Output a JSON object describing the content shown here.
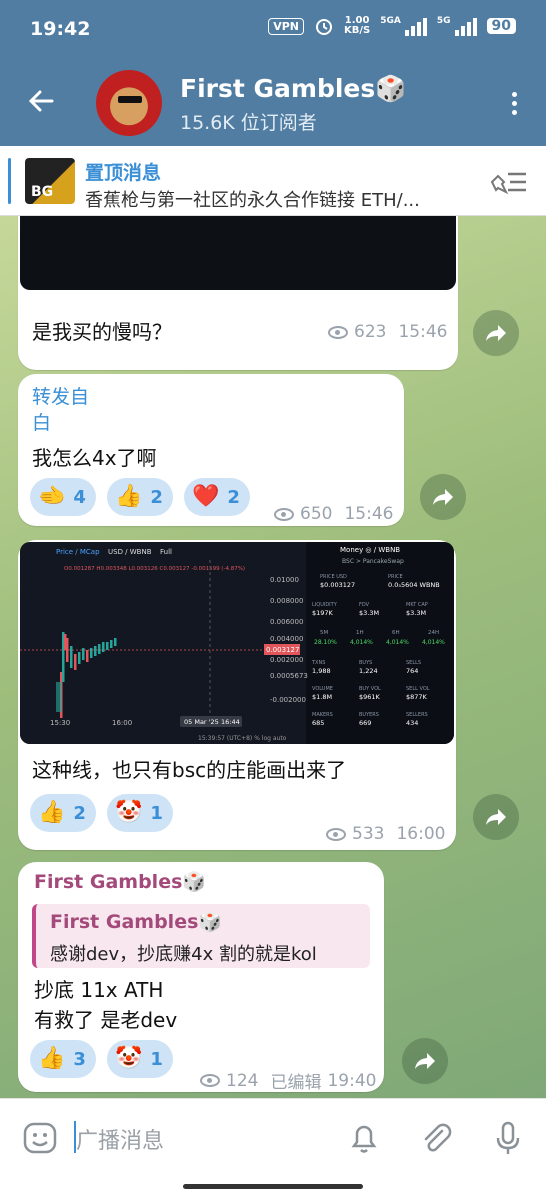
{
  "status_bar": {
    "time": "19:42",
    "vpn": "VPN",
    "speed_value": "1.00",
    "speed_unit": "KB/S",
    "net1": "5GA",
    "net2": "5G",
    "battery": "90"
  },
  "header": {
    "channel_name": "First Gambles🎲",
    "subscribers": "15.6K 位订阅者"
  },
  "pinned": {
    "heading": "置顶消息",
    "text": "香蕉枪与第一社区的永久合作链接 ETH/...",
    "thumb_label": "BG"
  },
  "messages": [
    {
      "text": "是我买的慢吗？",
      "views": "623",
      "time": "15:46"
    },
    {
      "forward_label": "转发自",
      "forward_from": "白",
      "text": "我怎么4x了啊",
      "reactions": [
        {
          "emoji": "🫲",
          "count": "4"
        },
        {
          "emoji": "👍",
          "count": "2"
        },
        {
          "emoji": "❤️",
          "count": "2"
        }
      ],
      "views": "650",
      "time": "15:46"
    },
    {
      "text": "这种线，也只有bsc的庄能画出来了",
      "reactions": [
        {
          "emoji": "👍",
          "count": "2"
        },
        {
          "emoji": "🤡",
          "count": "1"
        }
      ],
      "views": "533",
      "time": "16:00"
    },
    {
      "author": "First Gambles🎲",
      "quote_author": "First Gambles🎲",
      "quote_text": "感谢dev，抄底赚4x 割的就是kol",
      "text_line1": "抄底 11x ATH",
      "text_line2": "有救了 是老dev",
      "reactions": [
        {
          "emoji": "👍",
          "count": "3"
        },
        {
          "emoji": "🤡",
          "count": "1"
        }
      ],
      "views": "124",
      "edited": "已编辑",
      "time": "19:40"
    }
  ],
  "chart_screenshot": {
    "toolbar": [
      "Price / MCap",
      "USD / WBNB",
      "Full"
    ],
    "ohlc": "O0.001287 H0.003348 L0.003126 C0.003127 -0.001599 (-4.87%)",
    "price_ticks": [
      "0.01000",
      "0.008000",
      "0.006000",
      "0.004000",
      "0.002000",
      "0.0005673",
      "-0.002000"
    ],
    "current_price": "0.003127",
    "time_ticks": [
      "15:30",
      "16:00",
      "05 Mar '25",
      "16:44"
    ],
    "footer": "15:39:57 (UTC+8)   %   log   auto",
    "token": "Money ◎ / WBNB",
    "chain": "BSC > PancakeSwap",
    "stats": [
      {
        "label": "PRICE USD",
        "value": "$0.003127"
      },
      {
        "label": "PRICE",
        "value": "0.0₅5604 WBNB"
      },
      {
        "label": "LIQUIDITY",
        "value": "$197K"
      },
      {
        "label": "FDV",
        "value": "$3.3M"
      },
      {
        "label": "MKT CAP",
        "value": "$3.3M"
      }
    ],
    "periods": [
      {
        "label": "5M",
        "value": "28.10%"
      },
      {
        "label": "1H",
        "value": "4,014%"
      },
      {
        "label": "6H",
        "value": "4,014%"
      },
      {
        "label": "24H",
        "value": "4,014%"
      }
    ],
    "txns": [
      {
        "label": "TXNS",
        "value": "1,988"
      },
      {
        "label": "BUYS",
        "value": "1,224"
      },
      {
        "label": "SELLS",
        "value": "764"
      },
      {
        "label": "VOLUME",
        "value": "$1.8M"
      },
      {
        "label": "BUY VOL",
        "value": "$961K"
      },
      {
        "label": "SELL VOL",
        "value": "$877K"
      },
      {
        "label": "MAKERS",
        "value": "685"
      },
      {
        "label": "BUYERS",
        "value": "669"
      },
      {
        "label": "SELLERS",
        "value": "434"
      }
    ]
  },
  "input": {
    "placeholder": "广播消息"
  },
  "colors": {
    "header": "#517da2",
    "accent": "#3a8fd6",
    "author": "#a44a7a"
  }
}
